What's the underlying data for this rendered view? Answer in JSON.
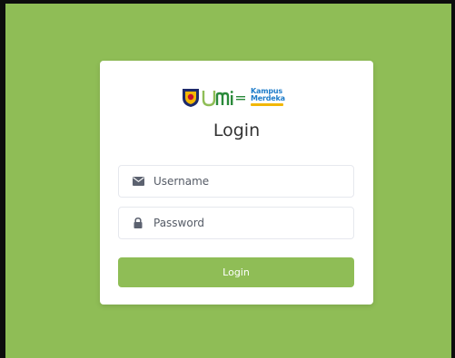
{
  "logo": {
    "brand": "Umi",
    "kampus_line1": "Kampus",
    "kampus_line2": "Merdeka"
  },
  "login_form": {
    "title": "Login",
    "username": {
      "placeholder": "Username",
      "value": "",
      "icon": "envelope-icon"
    },
    "password": {
      "placeholder": "Password",
      "value": "",
      "icon": "lock-icon"
    },
    "submit_label": "Login"
  },
  "colors": {
    "background": "#8fbd56",
    "button": "#8fbd56",
    "card": "#ffffff",
    "kampus_blue": "#1e7cc9"
  }
}
